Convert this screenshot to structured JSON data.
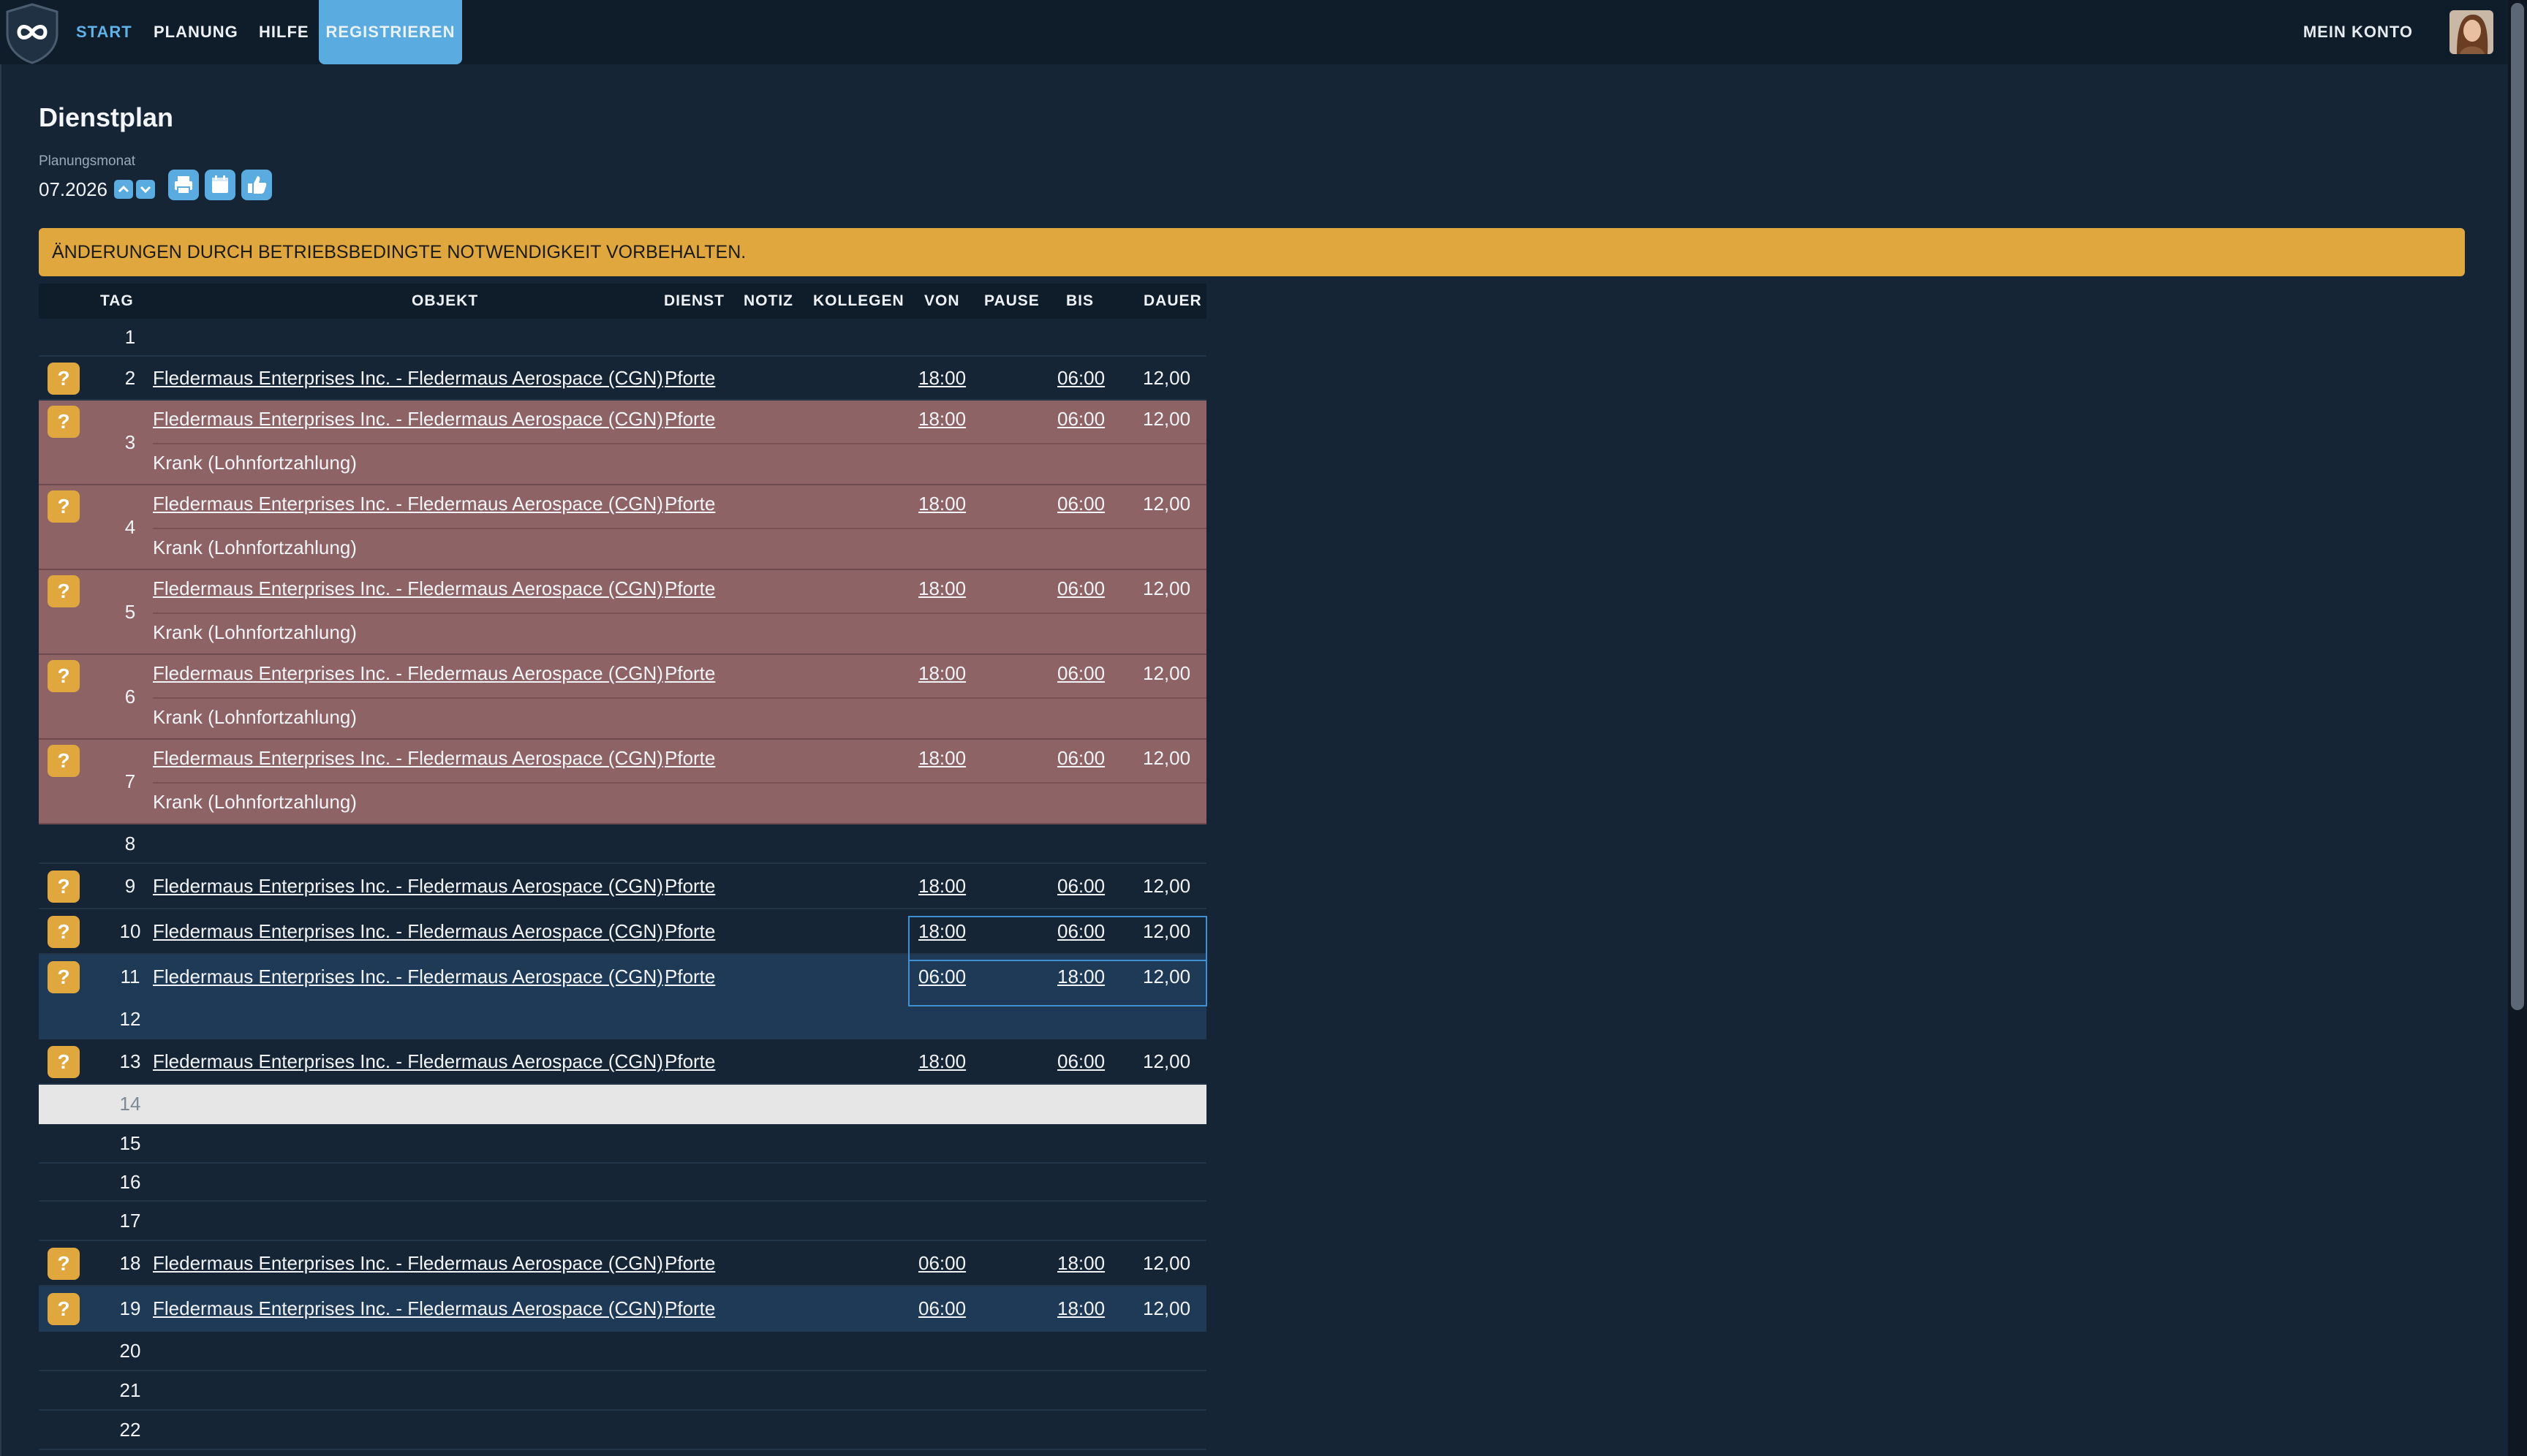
{
  "nav": {
    "start": "START",
    "planung": "PLANUNG",
    "hilfe": "HILFE",
    "registrieren": "REGISTRIEREN",
    "account": "MEIN KONTO"
  },
  "page": {
    "title": "Dienstplan",
    "month_label": "Planungsmonat",
    "month_value": "07.2026",
    "notice": "ÄNDERUNGEN DURCH BETRIEBSBEDINGTE NOTWENDIGKEIT VORBEHALTEN."
  },
  "table": {
    "headers": {
      "tag": "TAG",
      "objekt": "OBJEKT",
      "dienst": "DIENST",
      "notiz": "NOTIZ",
      "kollegen": "KOLLEGEN",
      "von": "VON",
      "pause": "PAUSE",
      "bis": "BIS",
      "dauer": "DAUER"
    },
    "badge": "?",
    "sick_note": "Krank (Lohnfortzahlung)",
    "rows": [
      {
        "day": "1"
      },
      {
        "day": "2",
        "objekt": "Fledermaus Enterprises Inc. - Fledermaus Aerospace (CGN)",
        "dienst": "Pforte",
        "von": "18:00",
        "bis": "06:00",
        "dauer": "12,00"
      },
      {
        "day": "3",
        "objekt": "Fledermaus Enterprises Inc. - Fledermaus Aerospace (CGN)",
        "dienst": "Pforte",
        "von": "18:00",
        "bis": "06:00",
        "dauer": "12,00",
        "note": "Krank (Lohnfortzahlung)"
      },
      {
        "day": "4",
        "objekt": "Fledermaus Enterprises Inc. - Fledermaus Aerospace (CGN)",
        "dienst": "Pforte",
        "von": "18:00",
        "bis": "06:00",
        "dauer": "12,00",
        "note": "Krank (Lohnfortzahlung)"
      },
      {
        "day": "5",
        "objekt": "Fledermaus Enterprises Inc. - Fledermaus Aerospace (CGN)",
        "dienst": "Pforte",
        "von": "18:00",
        "bis": "06:00",
        "dauer": "12,00",
        "note": "Krank (Lohnfortzahlung)"
      },
      {
        "day": "6",
        "objekt": "Fledermaus Enterprises Inc. - Fledermaus Aerospace (CGN)",
        "dienst": "Pforte",
        "von": "18:00",
        "bis": "06:00",
        "dauer": "12,00",
        "note": "Krank (Lohnfortzahlung)"
      },
      {
        "day": "7",
        "objekt": "Fledermaus Enterprises Inc. - Fledermaus Aerospace (CGN)",
        "dienst": "Pforte",
        "von": "18:00",
        "bis": "06:00",
        "dauer": "12,00",
        "note": "Krank (Lohnfortzahlung)"
      },
      {
        "day": "8"
      },
      {
        "day": "9",
        "objekt": "Fledermaus Enterprises Inc. - Fledermaus Aerospace (CGN)",
        "dienst": "Pforte",
        "von": "18:00",
        "bis": "06:00",
        "dauer": "12,00"
      },
      {
        "day": "10",
        "objekt": "Fledermaus Enterprises Inc. - Fledermaus Aerospace (CGN)",
        "dienst": "Pforte",
        "von": "18:00",
        "bis": "06:00",
        "dauer": "12,00"
      },
      {
        "day": "11",
        "objekt": "Fledermaus Enterprises Inc. - Fledermaus Aerospace (CGN)",
        "dienst": "Pforte",
        "von": "06:00",
        "bis": "18:00",
        "dauer": "12,00"
      },
      {
        "day": "12"
      },
      {
        "day": "13",
        "objekt": "Fledermaus Enterprises Inc. - Fledermaus Aerospace (CGN)",
        "dienst": "Pforte",
        "von": "18:00",
        "bis": "06:00",
        "dauer": "12,00"
      },
      {
        "day": "14"
      },
      {
        "day": "15"
      },
      {
        "day": "16"
      },
      {
        "day": "17"
      },
      {
        "day": "18",
        "objekt": "Fledermaus Enterprises Inc. - Fledermaus Aerospace (CGN)",
        "dienst": "Pforte",
        "von": "06:00",
        "bis": "18:00",
        "dauer": "12,00"
      },
      {
        "day": "19",
        "objekt": "Fledermaus Enterprises Inc. - Fledermaus Aerospace (CGN)",
        "dienst": "Pforte",
        "von": "06:00",
        "bis": "18:00",
        "dauer": "12,00"
      },
      {
        "day": "20"
      },
      {
        "day": "21"
      },
      {
        "day": "22"
      }
    ]
  }
}
